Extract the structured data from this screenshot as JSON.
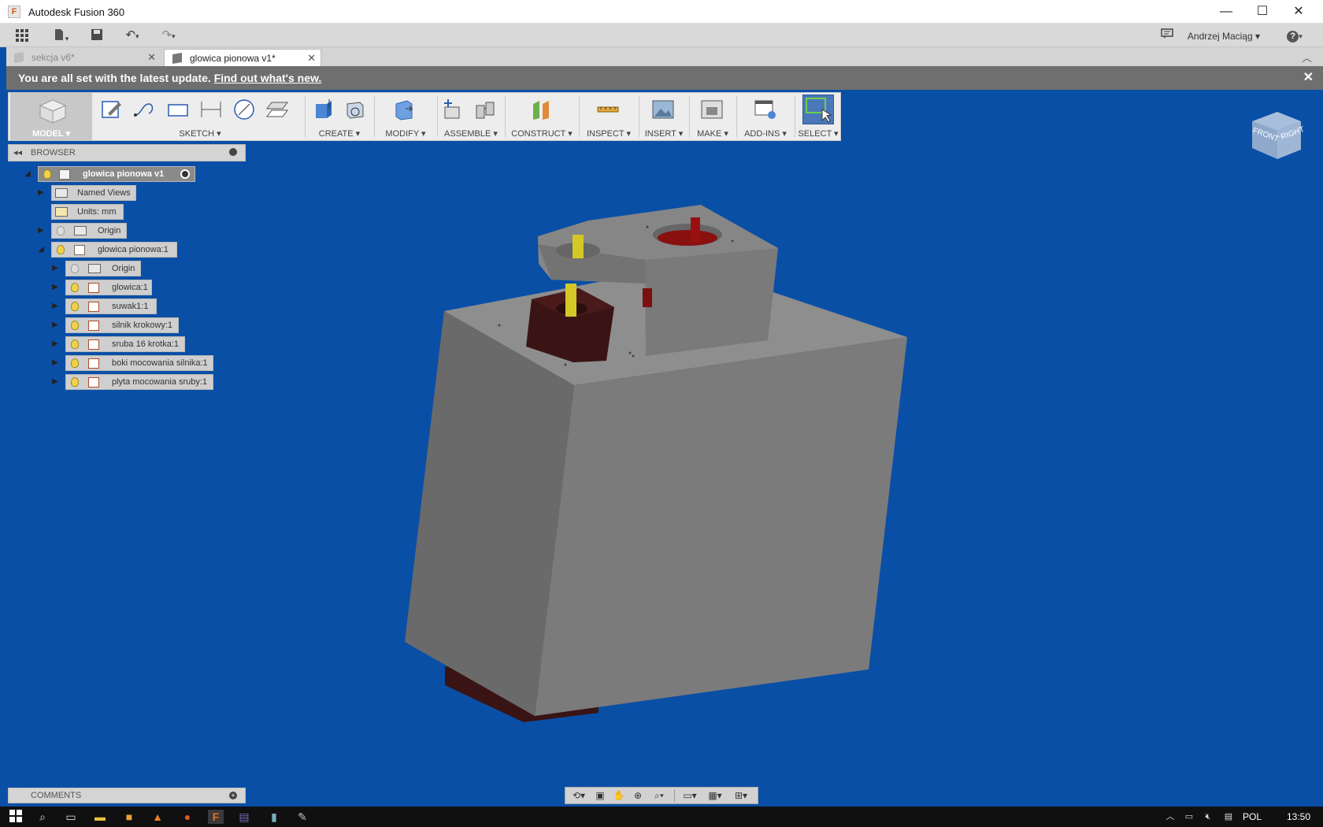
{
  "window": {
    "title": "Autodesk Fusion 360",
    "app_icon": "F",
    "minimize": "—",
    "maximize": "☐",
    "close": "✕"
  },
  "quick_access": {
    "user": "Andrzej Maciąg",
    "help": "?"
  },
  "tabs": [
    {
      "label": "sekcja v6*",
      "active": false
    },
    {
      "label": "glowica pionowa v1*",
      "active": true
    }
  ],
  "notification": {
    "text": "You are all set with the latest update.",
    "link": "Find out what's new."
  },
  "ribbon": {
    "model": "MODEL ▾",
    "sketch": "SKETCH ▾",
    "create": "CREATE ▾",
    "modify": "MODIFY ▾",
    "assemble": "ASSEMBLE ▾",
    "construct": "CONSTRUCT ▾",
    "inspect": "INSPECT ▾",
    "insert": "INSERT ▾",
    "make": "MAKE ▾",
    "addins": "ADD-INS ▾",
    "select": "SELECT ▾"
  },
  "browser": {
    "title": "BROWSER",
    "root": "glowica pionowa v1",
    "named_views": "Named Views",
    "units": "Units: mm",
    "origin": "Origin",
    "component": "glowica pionowa:1",
    "sub_origin": "Origin",
    "children": [
      "glowica:1",
      "suwak1:1",
      "silnik krokowy:1",
      "sruba 16 krotka:1",
      "boki mocowania silnika:1",
      "plyta mocowania sruby:1"
    ]
  },
  "comments": {
    "title": "COMMENTS"
  },
  "viewcube": {
    "front": "FRONT",
    "right": "RIGHT"
  },
  "taskbar": {
    "lang": "POL",
    "time": "13:50"
  },
  "colors": {
    "viewport": "#0a4fa6",
    "ribbon": "#ededed",
    "notification": "#6f6f6f",
    "part": "#7c7c7c",
    "motor": "#3a1414",
    "screw": "#d4c826"
  }
}
